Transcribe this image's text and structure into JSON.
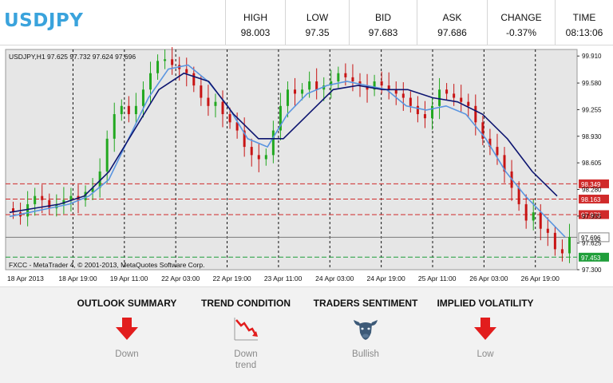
{
  "header": {
    "symbol": "USDJPY",
    "stats": [
      {
        "label": "HIGH",
        "value": "98.003"
      },
      {
        "label": "LOW",
        "value": "97.35"
      },
      {
        "label": "BID",
        "value": "97.683"
      },
      {
        "label": "ASK",
        "value": "97.686"
      },
      {
        "label": "CHANGE",
        "value": "-0.37%"
      },
      {
        "label": "TIME",
        "value": "08:13:06"
      }
    ]
  },
  "chart": {
    "info": "USDJPY,H1  97.625 97.732 97.624 97.696",
    "footer": "FXCC - MetaTrader 4, © 2001-2013, MetaQuotes Software Corp.",
    "price_ticks": [
      "99.910",
      "99.580",
      "99.255",
      "98.930",
      "98.605",
      "98.280",
      "97.955",
      "97.625",
      "97.300"
    ],
    "time_ticks": [
      "18 Apr 2013",
      "18 Apr 19:00",
      "19 Apr 11:00",
      "22 Apr 03:00",
      "22 Apr 19:00",
      "23 Apr 11:00",
      "24 Apr 03:00",
      "24 Apr 19:00",
      "25 Apr 11:00",
      "26 Apr 03:00",
      "26 Apr 19:00"
    ],
    "levels": [
      {
        "value": "98.349",
        "color": "#d02a2a",
        "style": "dashed"
      },
      {
        "value": "98.163",
        "color": "#d02a2a",
        "style": "dashed"
      },
      {
        "value": "97.973",
        "color": "#d02a2a",
        "style": "dashed"
      },
      {
        "value": "97.696",
        "color": "#7a7a7a",
        "style": "solid"
      },
      {
        "value": "97.453",
        "color": "#1f9e3a",
        "style": "dashed"
      }
    ],
    "colors": {
      "bull": "#22a820",
      "bear": "#c81414",
      "fast_ma": "#5a95e0",
      "slow_ma": "#0d1570",
      "background": "#e6e6e6"
    }
  },
  "chart_data": {
    "type": "candlestick",
    "title": "USDJPY,H1",
    "ylim": [
      97.3,
      99.99
    ],
    "close_approx": [
      98.0,
      97.95,
      98.1,
      98.2,
      98.15,
      98.05,
      98.1,
      98.15,
      98.2,
      98.15,
      98.25,
      98.3,
      98.5,
      98.9,
      99.2,
      99.3,
      99.2,
      99.3,
      99.5,
      99.7,
      99.85,
      99.87,
      99.8,
      99.75,
      99.7,
      99.55,
      99.4,
      99.3,
      99.35,
      99.2,
      99.1,
      99.0,
      98.8,
      98.7,
      98.65,
      98.7,
      99.0,
      99.3,
      99.5,
      99.45,
      99.5,
      99.6,
      99.5,
      99.55,
      99.6,
      99.7,
      99.65,
      99.6,
      99.55,
      99.5,
      99.6,
      99.55,
      99.5,
      99.45,
      99.4,
      99.3,
      99.2,
      99.15,
      99.3,
      99.5,
      99.45,
      99.4,
      99.35,
      99.3,
      99.1,
      98.9,
      98.8,
      98.7,
      98.5,
      98.3,
      98.1,
      97.9,
      98.0,
      97.8,
      97.75,
      97.55,
      97.5,
      97.7
    ],
    "series": [
      {
        "name": "fast MA",
        "approx": [
          97.95,
          98.0,
          98.05,
          98.1,
          98.2,
          98.4,
          98.9,
          99.4,
          99.75,
          99.8,
          99.6,
          99.3,
          98.9,
          98.8,
          99.2,
          99.45,
          99.55,
          99.6,
          99.55,
          99.5,
          99.3,
          99.25,
          99.3,
          99.2,
          98.9,
          98.5,
          98.2,
          97.95,
          97.7
        ]
      },
      {
        "name": "slow MA",
        "approx": [
          98.0,
          98.05,
          98.1,
          98.2,
          98.5,
          99.0,
          99.5,
          99.7,
          99.6,
          99.2,
          98.9,
          98.9,
          99.2,
          99.5,
          99.55,
          99.5,
          99.5,
          99.4,
          99.35,
          99.2,
          98.9,
          98.5,
          98.2
        ]
      }
    ]
  },
  "bottom": {
    "panels": [
      {
        "title": "OUTLOOK SUMMARY",
        "icon": "down-arrow-icon",
        "text": "Down"
      },
      {
        "title": "TREND CONDITION",
        "icon": "down-trend-icon",
        "text": "Down trend"
      },
      {
        "title": "TRADERS SENTIMENT",
        "icon": "bull-icon",
        "text": "Bullish"
      },
      {
        "title": "IMPLIED VOLATILITY",
        "icon": "down-arrow-icon",
        "text": "Low"
      }
    ]
  }
}
